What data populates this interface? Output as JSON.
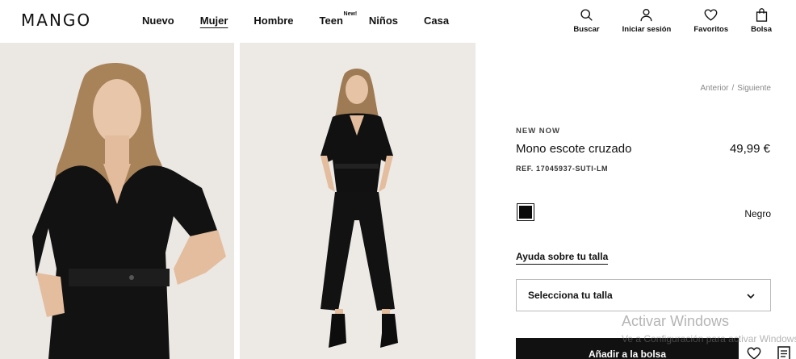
{
  "header": {
    "logo": "MANGO",
    "nav": [
      {
        "label": "Nuevo"
      },
      {
        "label": "Mujer",
        "active": true
      },
      {
        "label": "Hombre"
      },
      {
        "label": "Teen",
        "badge": "New!"
      },
      {
        "label": "Niños"
      },
      {
        "label": "Casa"
      }
    ],
    "actions": [
      {
        "label": "Buscar",
        "icon": "search-icon"
      },
      {
        "label": "Iniciar sesión",
        "icon": "user-icon"
      },
      {
        "label": "Favoritos",
        "icon": "heart-icon"
      },
      {
        "label": "Bolsa",
        "icon": "bag-icon"
      }
    ]
  },
  "product": {
    "prev": "Anterior",
    "separator": "/",
    "next": "Siguiente",
    "badge": "NEW NOW",
    "title": "Mono escote cruzado",
    "price": "49,99 €",
    "ref": "REF. 17045937-SUTI-LM",
    "color_name": "Negro",
    "color_hex": "#0b0b0b",
    "size_help": "Ayuda sobre tu talla",
    "size_placeholder": "Selecciona tu talla",
    "add_to_bag": "Añadir a la bolsa"
  },
  "watermark": {
    "line1": "Activar Windows",
    "line2": "Ve a Configuración para activar Windows."
  }
}
